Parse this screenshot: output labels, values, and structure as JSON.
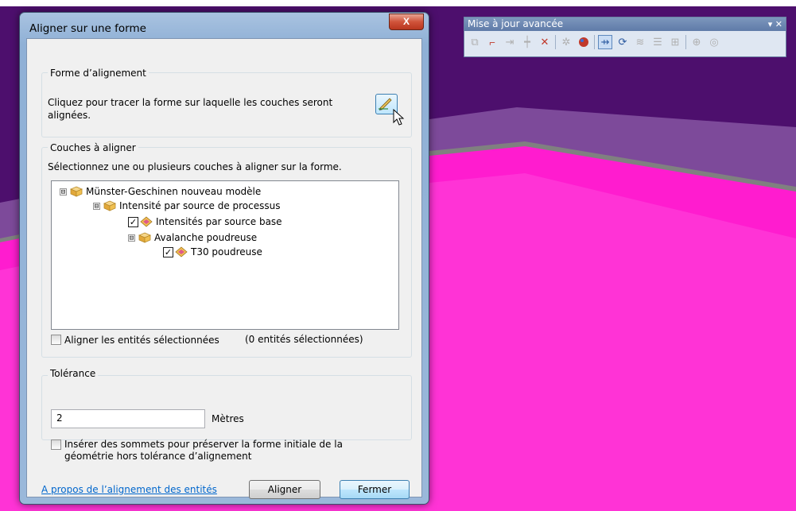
{
  "dialog": {
    "title": "Aligner sur une forme",
    "close_label": "X",
    "shape_group": {
      "legend": "Forme d’alignement",
      "instruction": "Cliquez pour tracer la forme sur laquelle les couches seront alignées."
    },
    "layers_group": {
      "legend": "Couches à aligner",
      "instruction": "Sélectionnez une ou plusieurs couches à aligner sur la forme.",
      "tree": [
        {
          "label": "Münster-Geschinen nouveau modèle",
          "expander": "⊟"
        },
        {
          "label": "Intensité par source de processus",
          "expander": "⊟"
        },
        {
          "label": "Intensités par source base",
          "checked": "✓"
        },
        {
          "label": "Avalanche poudreuse",
          "expander": "⊟"
        },
        {
          "label": "T30 poudreuse",
          "checked": "✓"
        }
      ],
      "align_selected_label": "Aligner les entités sélectionnées",
      "selected_count": "(0 entités sélectionnées)"
    },
    "tolerance_group": {
      "legend": "Tolérance",
      "value": "2",
      "unit": "Mètres"
    },
    "insert_vertices_label": "Insérer des sommets pour préserver la forme initiale de la géométrie hors tolérance d’alignement",
    "about_link": "A propos de l’alignement des entités",
    "align_button": "Aligner",
    "close_button": "Fermer"
  },
  "toolbar": {
    "title": "Mise à jour avancée",
    "controls": "▾ ✕",
    "icons": [
      "copy-features-icon",
      "fillet-icon",
      "extend-icon",
      "trim-icon",
      "line-intersection-icon",
      "explode-icon",
      "generalize-icon",
      "align-to-shape-icon",
      "replace-geometry-icon",
      "smooth-icon",
      "construct-geodetic-icon",
      "construct-points-icon",
      "rotate-icon",
      "topology-icon"
    ]
  },
  "colors": {
    "accent": "#ff33cc",
    "background_dark": "#4a0d6b"
  }
}
